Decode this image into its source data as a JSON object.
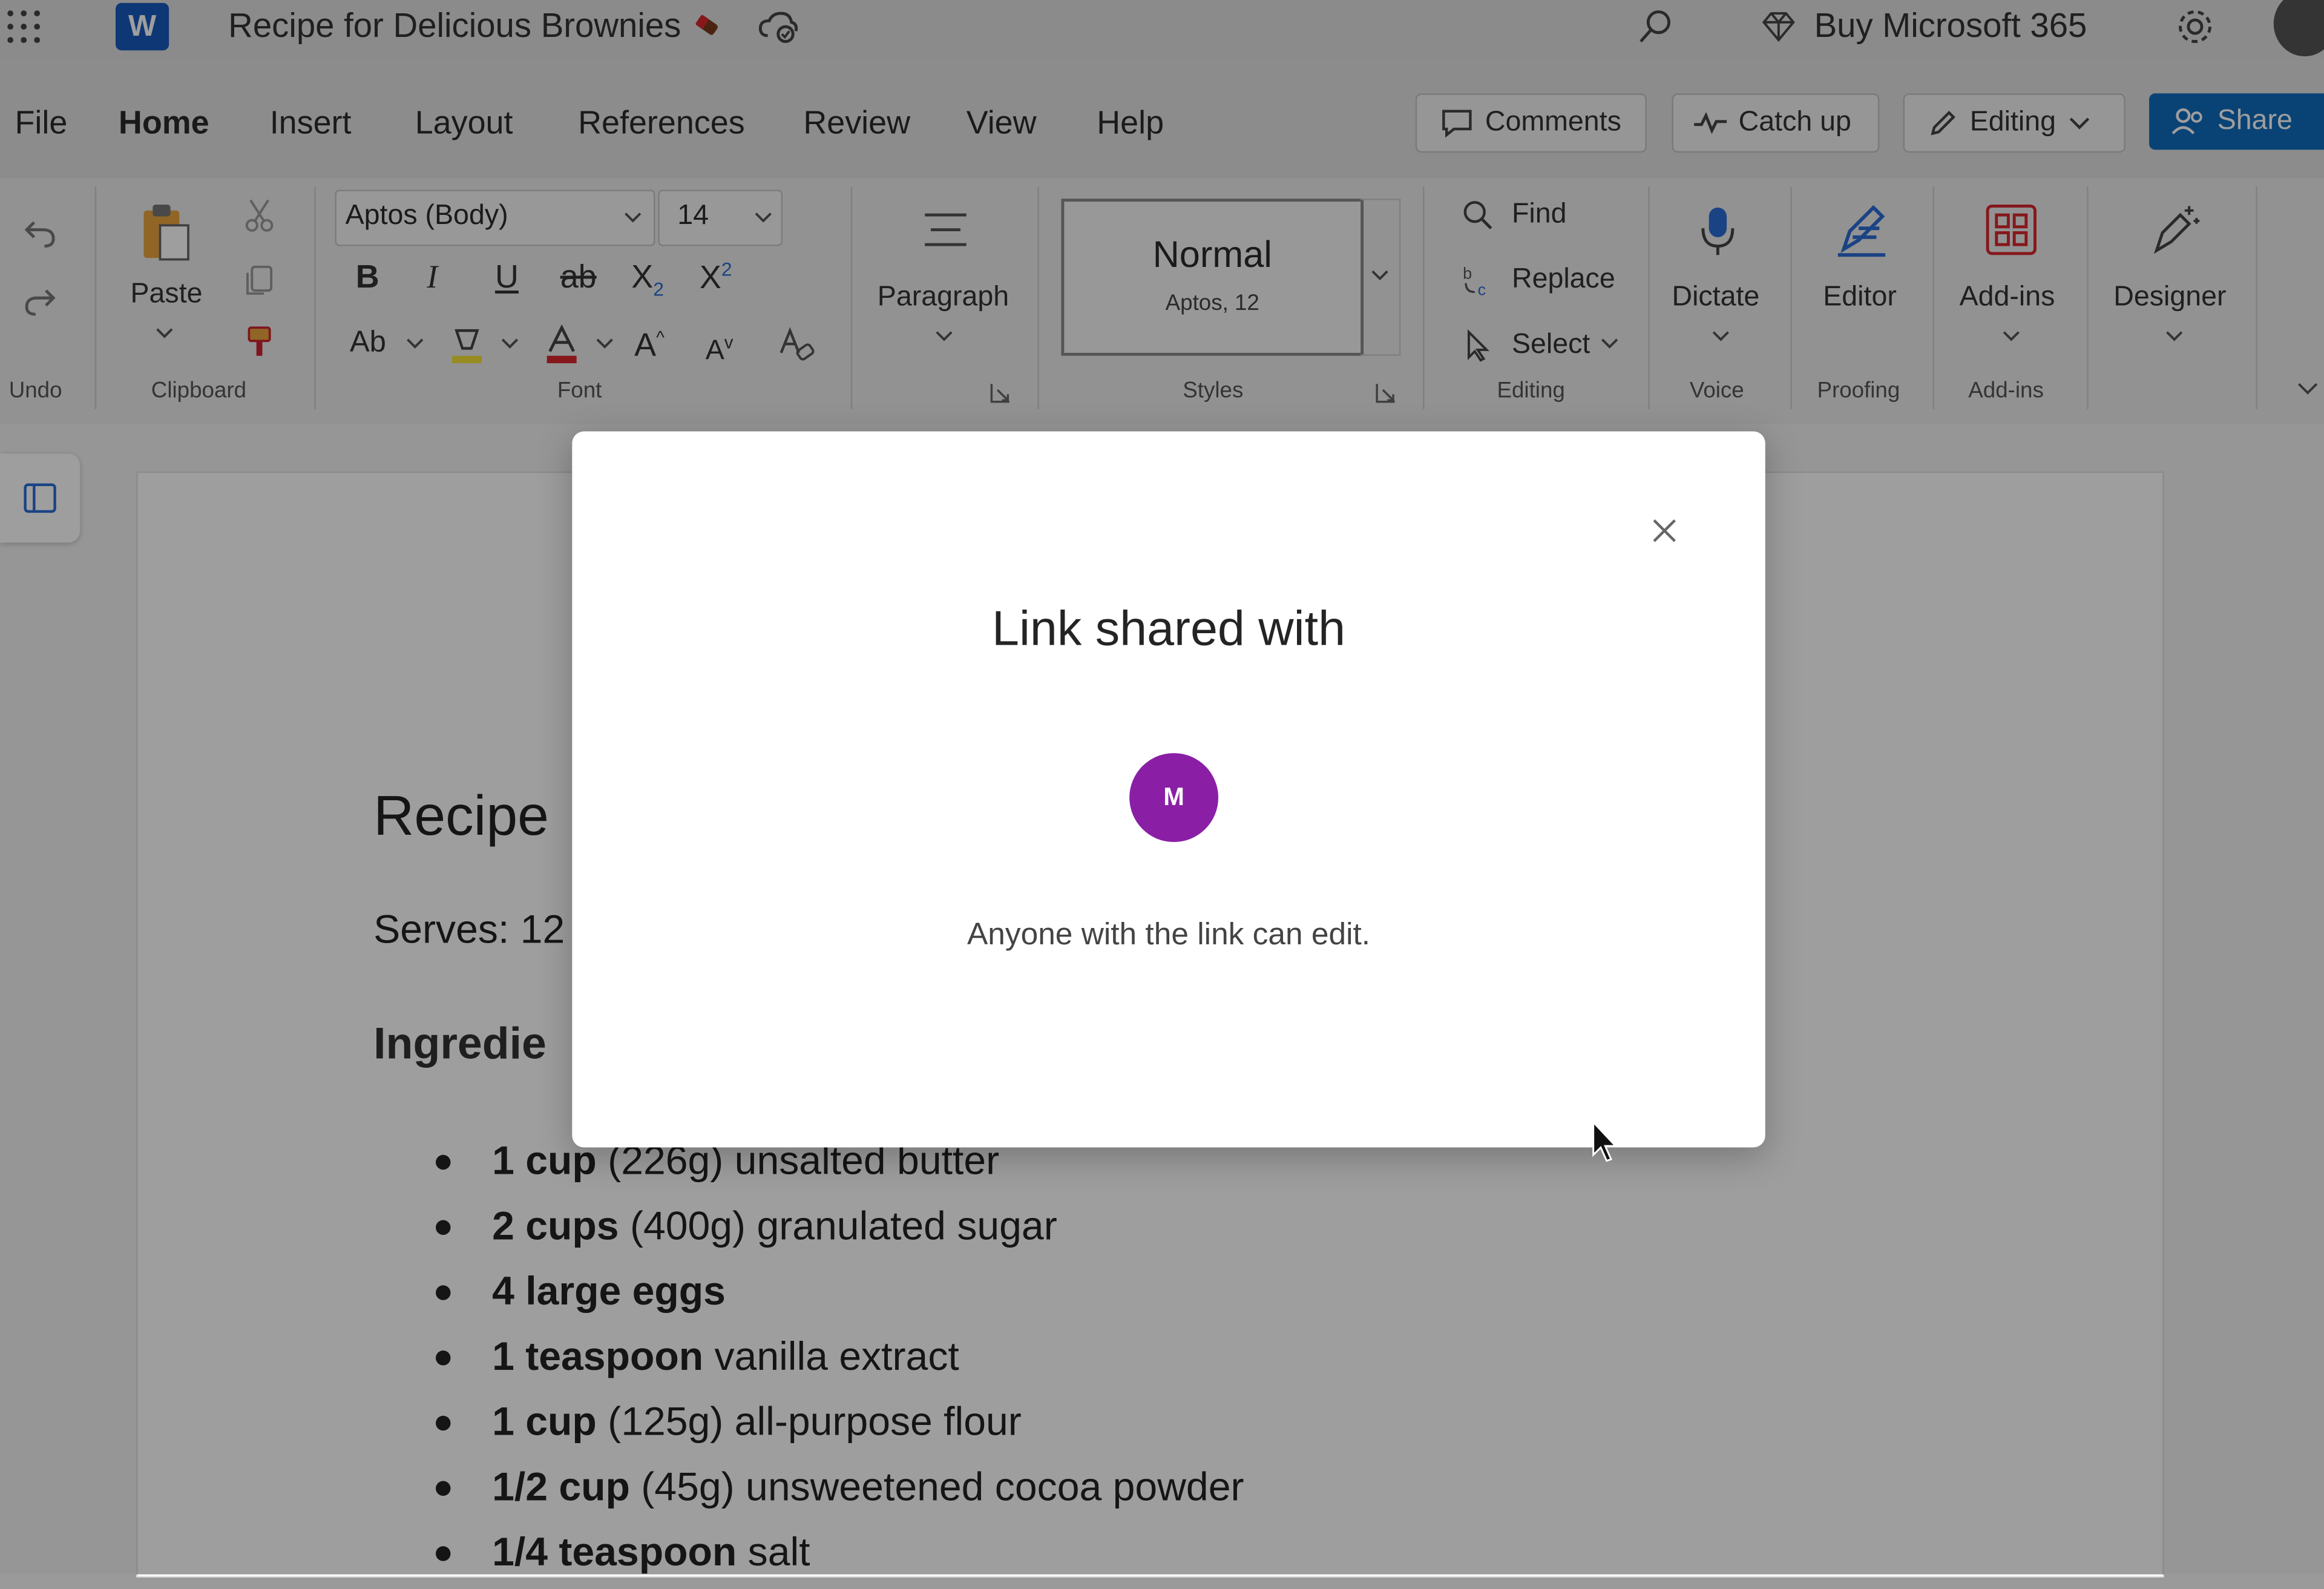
{
  "titlebar": {
    "doc_title": "Recipe for Delicious Brownies",
    "buy_label": "Buy Microsoft 365",
    "app_icon_letter": "W"
  },
  "menu": {
    "tabs": [
      "File",
      "Home",
      "Insert",
      "Layout",
      "References",
      "Review",
      "View",
      "Help"
    ],
    "active_tab": "Home",
    "comments_label": "Comments",
    "catchup_label": "Catch up",
    "editing_label": "Editing",
    "share_label": "Share"
  },
  "ribbon": {
    "undo_group": "Undo",
    "paste_label": "Paste",
    "clipboard_group": "Clipboard",
    "font_name": "Aptos (Body)",
    "font_size": "14",
    "font_group": "Font",
    "paragraph_label": "Paragraph",
    "style_name": "Normal",
    "style_sub": "Aptos, 12",
    "styles_group": "Styles",
    "find_label": "Find",
    "replace_label": "Replace",
    "select_label": "Select",
    "editing_group": "Editing",
    "dictate_label": "Dictate",
    "voice_group": "Voice",
    "editor_label": "Editor",
    "proofing_group": "Proofing",
    "addins_label": "Add-ins",
    "addins_group": "Add-ins",
    "designer_label": "Designer"
  },
  "document": {
    "heading": "Recipe",
    "serves": "Serves: 12",
    "ingredients_heading": "Ingredie",
    "items": [
      {
        "bold": "1 cup",
        "rest": " (226g) unsalted butter"
      },
      {
        "bold": "2 cups",
        "rest": " (400g) granulated sugar"
      },
      {
        "bold": "4 large eggs",
        "rest": ""
      },
      {
        "bold": "1 teaspoon",
        "rest": " vanilla extract"
      },
      {
        "bold": "1 cup",
        "rest": " (125g) all-purpose flour"
      },
      {
        "bold": "1/2 cup",
        "rest": " (45g) unsweetened cocoa powder"
      },
      {
        "bold": "1/4 teaspoon",
        "rest": " salt"
      }
    ]
  },
  "dialog": {
    "title": "Link shared with",
    "avatar_initial": "M",
    "message": "Anyone with the link can edit.",
    "avatar_color": "#8a1fa6"
  },
  "colors": {
    "word_blue": "#185abd",
    "share_button": "#0f6cbd"
  }
}
